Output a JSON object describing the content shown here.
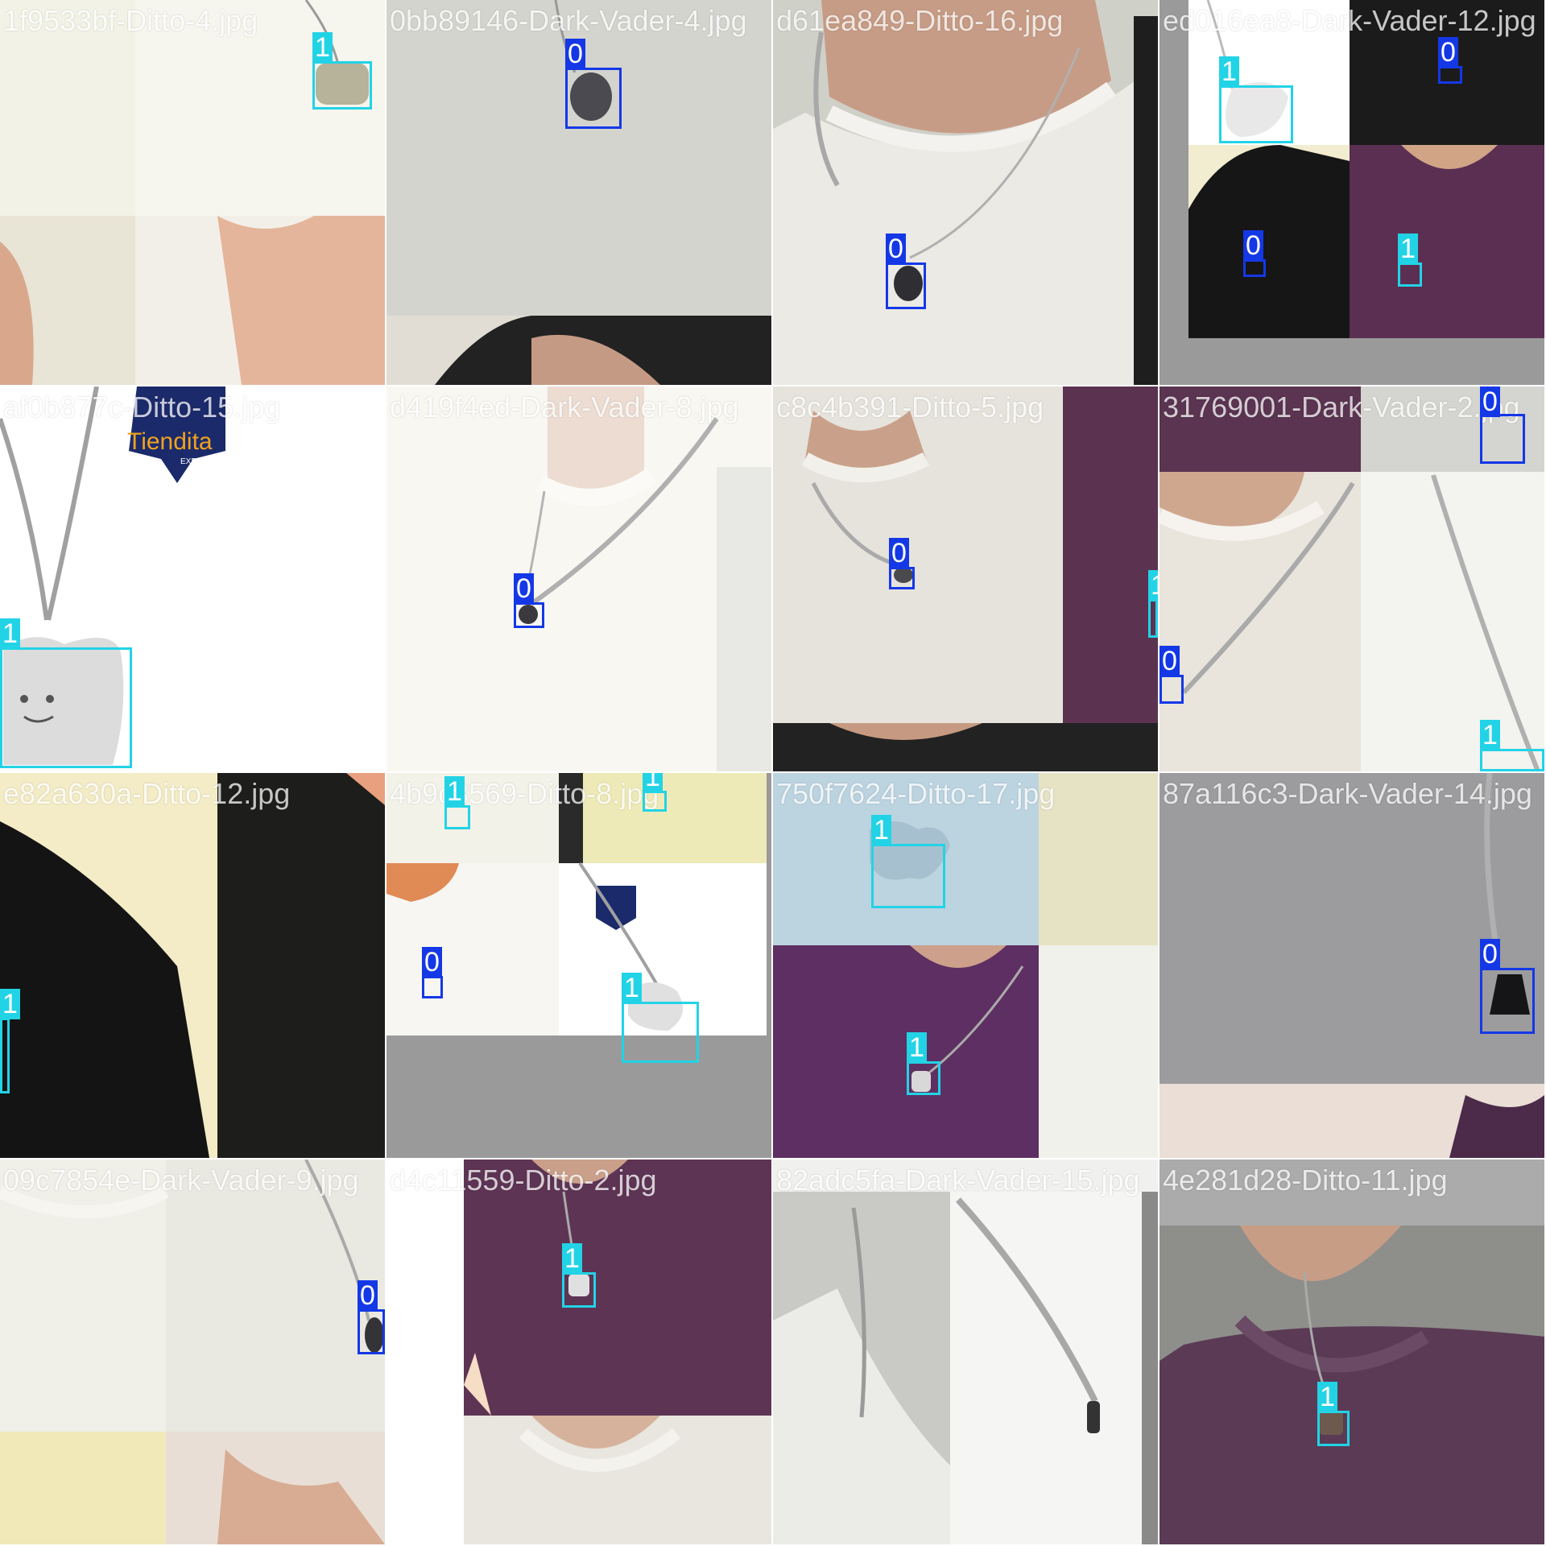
{
  "mosaic": {
    "tiles": [
      {
        "filename": "1f9533bf-Ditto-4.jpg",
        "detections": [
          {
            "label": "1",
            "class": 1
          }
        ]
      },
      {
        "filename": "0bb89146-Dark-Vader-4.jpg",
        "detections": [
          {
            "label": "0",
            "class": 0
          }
        ]
      },
      {
        "filename": "d61ea849-Ditto-16.jpg",
        "detections": [
          {
            "label": "0",
            "class": 0
          }
        ]
      },
      {
        "filename": "ed016ea8-Dark-Vader-12.jpg",
        "detections": [
          {
            "label": "0",
            "class": 0
          },
          {
            "label": "1",
            "class": 1
          },
          {
            "label": "0",
            "class": 0
          },
          {
            "label": "1",
            "class": 1
          }
        ]
      },
      {
        "filename": "af0b877c-Ditto-15.jpg",
        "detections": [
          {
            "label": "1",
            "class": 1
          }
        ]
      },
      {
        "filename": "d419f4ed-Dark-Vader-8.jpg",
        "detections": [
          {
            "label": "0",
            "class": 0
          }
        ]
      },
      {
        "filename": "c8c4b391-Ditto-5.jpg",
        "detections": [
          {
            "label": "0",
            "class": 0
          },
          {
            "label": "1",
            "class": 1
          }
        ]
      },
      {
        "filename": "31769001-Dark-Vader-2.jpg",
        "detections": [
          {
            "label": "0",
            "class": 0
          },
          {
            "label": "0",
            "class": 0
          },
          {
            "label": "1",
            "class": 1
          }
        ]
      },
      {
        "filename": "e82a630a-Ditto-12.jpg",
        "detections": [
          {
            "label": "1",
            "class": 1
          }
        ]
      },
      {
        "filename": "4b9c3569-Ditto-8.jpg",
        "detections": [
          {
            "label": "1",
            "class": 1
          },
          {
            "label": "1",
            "class": 1
          },
          {
            "label": "0",
            "class": 0
          },
          {
            "label": "1",
            "class": 1
          }
        ]
      },
      {
        "filename": "750f7624-Ditto-17.jpg",
        "detections": [
          {
            "label": "1",
            "class": 1
          },
          {
            "label": "1",
            "class": 1
          }
        ]
      },
      {
        "filename": "87a116c3-Dark-Vader-14.jpg",
        "detections": [
          {
            "label": "0",
            "class": 0
          }
        ]
      },
      {
        "filename": "09c7854e-Dark-Vader-9.jpg",
        "detections": [
          {
            "label": "0",
            "class": 0
          }
        ]
      },
      {
        "filename": "d4c11559-Ditto-2.jpg",
        "detections": [
          {
            "label": "1",
            "class": 1
          }
        ]
      },
      {
        "filename": "82adc5fa-Dark-Vader-15.jpg",
        "detections": []
      },
      {
        "filename": "4e281d28-Ditto-11.jpg",
        "detections": [
          {
            "label": "1",
            "class": 1
          }
        ]
      }
    ],
    "logo_text": "Tiendita",
    "logo_subtext": "EXPRESS"
  },
  "colors": {
    "class_0": "#1438e6",
    "class_1": "#22d3e6"
  }
}
